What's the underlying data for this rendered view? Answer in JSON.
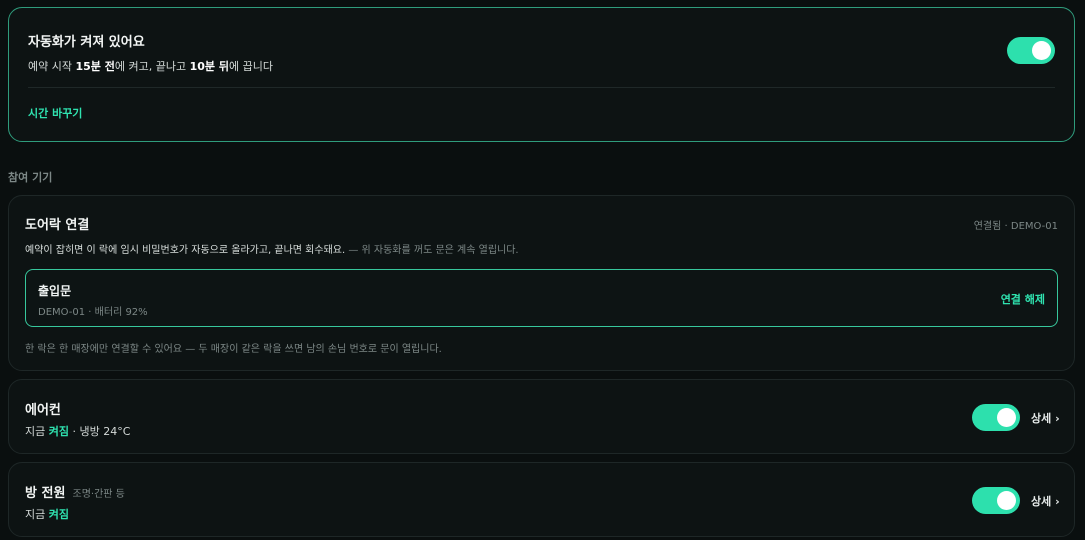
{
  "automation": {
    "title": "자동화가 켜져 있어요",
    "desc_prefix": "예약 시작 ",
    "start_offset": "15분 전",
    "desc_mid": "에 켜고, 끝나고 ",
    "end_offset": "10분 뒤",
    "desc_suffix": "에 끕니다",
    "toggle_on": true,
    "change_time_label": "시간 바꾸기"
  },
  "section": {
    "label": "참여 기기"
  },
  "doorlock": {
    "title": "도어락 연결",
    "status": "연결됨 · DEMO-01",
    "desc_main": "예약이 잡히면 이 락에 임시 비밀번호가 자동으로 올라가고, 끝나면 회수돼요.",
    "desc_note": " — 위 자동화를 꺼도 문은 계속 열립니다.",
    "device": {
      "name": "출입문",
      "meta": "DEMO-01 · 배터리 92%",
      "disconnect_label": "연결 해제"
    },
    "footnote": "한 락은 한 매장에만 연결할 수 있어요 — 두 매장이 같은 락을 쓰면 남의 손님 번호로 문이 열립니다."
  },
  "aircon": {
    "title": "에어컨",
    "status_prefix": "지금 ",
    "status_value": "켜짐",
    "status_suffix": " · 냉방 24°C",
    "toggle_on": true,
    "detail_label": "상세 ›"
  },
  "room_power": {
    "title": "방 전원",
    "subtitle": "조명·간판 등",
    "status_prefix": "지금 ",
    "status_value": "켜짐",
    "toggle_on": true,
    "detail_label": "상세 ›"
  },
  "colors": {
    "accent": "#2de0ad",
    "accent_border": "#2f9c7c",
    "background": "#0a0f0f",
    "card": "#0d1313"
  }
}
